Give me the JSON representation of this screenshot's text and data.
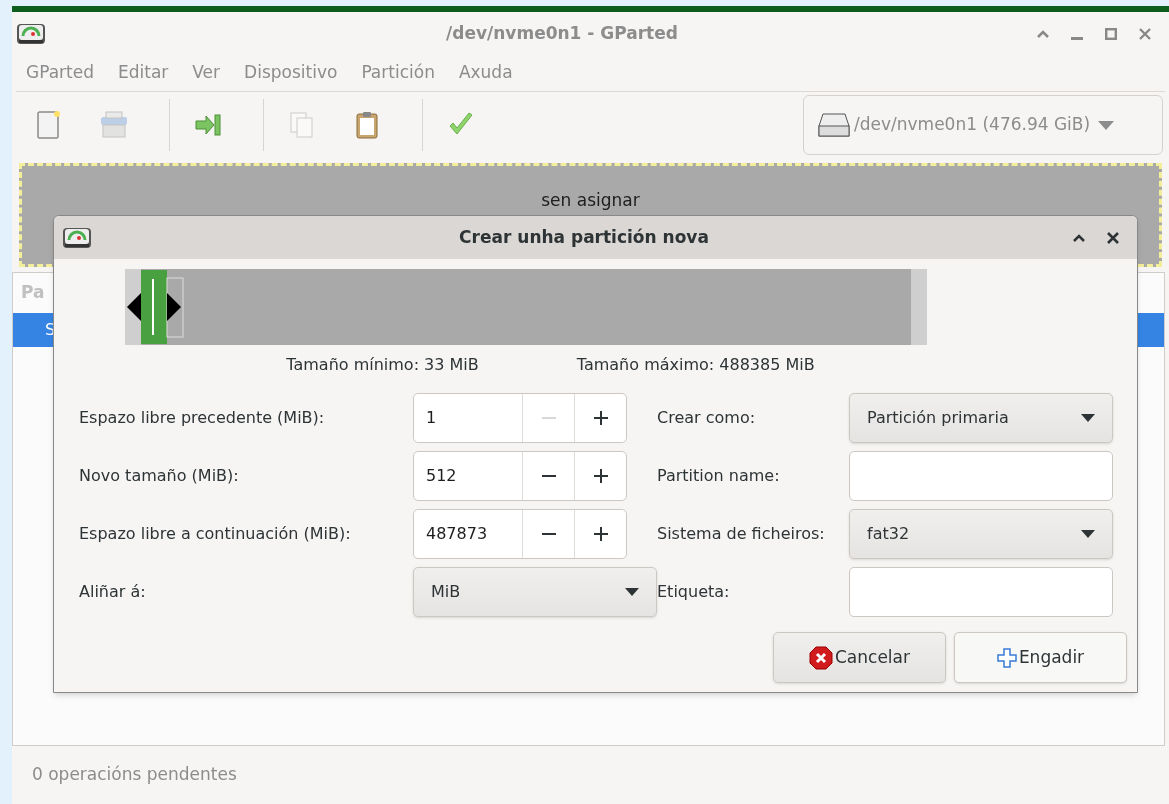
{
  "window": {
    "title": "/dev/nvme0n1 - GParted"
  },
  "menu": [
    "GParted",
    "Editar",
    "Ver",
    "Dispositivo",
    "Partición",
    "Axuda"
  ],
  "toolbar": [
    {
      "kind": "new",
      "disabled": false
    },
    {
      "kind": "delete",
      "disabled": true
    },
    {
      "kind": "sep"
    },
    {
      "kind": "resize",
      "disabled": false
    },
    {
      "kind": "sep"
    },
    {
      "kind": "copy",
      "disabled": true
    },
    {
      "kind": "paste",
      "disabled": false
    },
    {
      "kind": "sep"
    },
    {
      "kind": "apply",
      "disabled": false
    }
  ],
  "device": {
    "value": "/dev/nvme0n1 (476.94 GiB)"
  },
  "partition_map": {
    "label": "sen asignar"
  },
  "table": {
    "column_1": "Pa",
    "row_1": "S"
  },
  "dialog": {
    "title": "Crear unha partición nova",
    "min_size": "Tamaño mínimo: 33 MiB",
    "max_size": "Tamaño máximo: 488385 MiB",
    "left_fields": [
      {
        "label": "Espazo libre precedente (MiB):",
        "kind": "spin",
        "value": "1",
        "minus_disabled": true
      },
      {
        "label": "Novo tamaño (MiB):",
        "kind": "spin",
        "value": "512",
        "minus_disabled": false
      },
      {
        "label": "Espazo libre a continuación (MiB):",
        "kind": "spin",
        "value": "487873",
        "minus_disabled": false
      },
      {
        "label": "Aliñar á:",
        "kind": "combo",
        "value": "MiB"
      }
    ],
    "right_fields": [
      {
        "label": "Crear como:",
        "kind": "combo",
        "value": "Partición primaria"
      },
      {
        "label": "Partition name:",
        "kind": "entry"
      },
      {
        "label": "Sistema de ficheiros:",
        "kind": "combo",
        "value": "fat32"
      },
      {
        "label": "Etiqueta:",
        "kind": "entry"
      }
    ],
    "buttons": [
      {
        "label": "Cancelar",
        "kind": "cancel"
      },
      {
        "label": "Engadir",
        "kind": "add"
      }
    ]
  },
  "status_bar": "0 operacións pendentes"
}
